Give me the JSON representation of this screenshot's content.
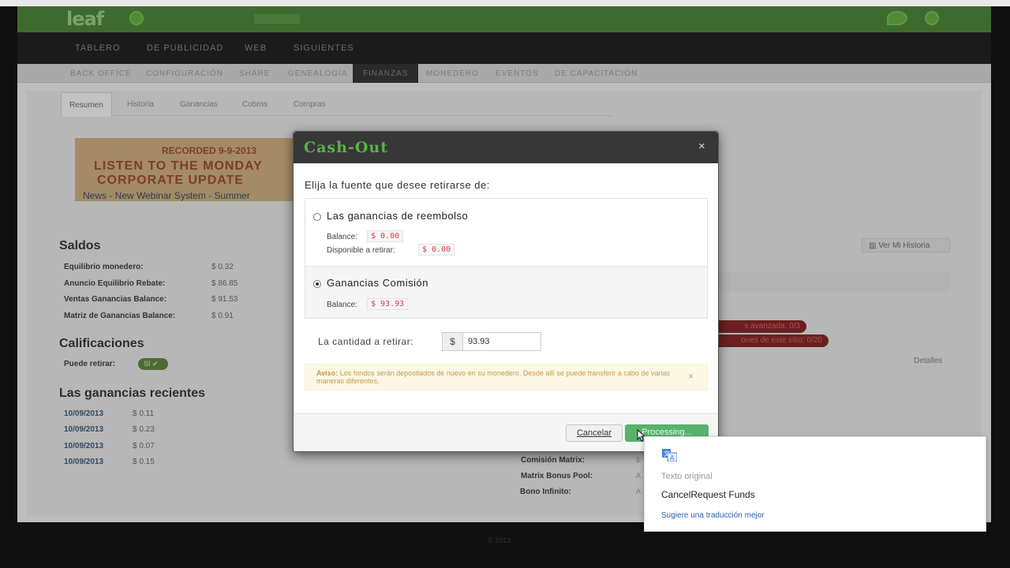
{
  "app": {
    "logo": "leaf"
  },
  "nav_main": [
    "TABLERO",
    "DE PUBLICIDAD",
    "WEB",
    "SIGUIENTES"
  ],
  "nav_sub": [
    "BACK OFFICE",
    "CONFIGURACIÓN",
    "SHARE",
    "GENEALOGÍA",
    "FINANZAS",
    "MONEDERO",
    "EVENTOS",
    "DE CAPACITACIÓN"
  ],
  "tabs": [
    "Resumen",
    "Historia",
    "Ganancias",
    "Cobros",
    "Compras"
  ],
  "banner": {
    "recorded": "RECORDED 9-9-2013",
    "line1": "LISTEN TO THE MONDAY",
    "line2": "CORPORATE UPDATE",
    "line3": "News  -  New Webinar System  -  Summer"
  },
  "saldos": {
    "title": "Saldos",
    "rows": [
      {
        "label": "Equilibrio monedero:",
        "value": "$ 0.32"
      },
      {
        "label": "Anuncio Equilibrio Rebate:",
        "value": "$ 86.85"
      },
      {
        "label": "Ventas Ganancias Balance:",
        "value": "$ 91.53"
      },
      {
        "label": "Matriz de Ganancias Balance:",
        "value": "$ 0.91"
      }
    ]
  },
  "calificaciones": {
    "title": "Calificaciones",
    "label": "Puede retirar:",
    "badge": "SI ✔"
  },
  "recientes": {
    "title": "Las ganancias recientes",
    "rows": [
      {
        "date": "10/09/2013",
        "amount": "$ 0.11"
      },
      {
        "date": "10/09/2013",
        "amount": "$ 0.23"
      },
      {
        "date": "10/09/2013",
        "amount": "$ 0.07"
      },
      {
        "date": "10/09/2013",
        "amount": "$ 0.15"
      }
    ]
  },
  "right_panel": {
    "history_button": "Ver Mi Historia",
    "pill1": "s avanzada: 0/3",
    "pill2": "ones de este sitio: 0/20",
    "detalles": "Detalles",
    "rows": [
      {
        "label": "Comisión Matrix:",
        "value": "$"
      },
      {
        "label": "Matrix Bonus Pool:",
        "value": "A"
      },
      {
        "label": "Bono Infinito:",
        "value": "A"
      }
    ]
  },
  "modal": {
    "title": "Cash-Out",
    "close": "×",
    "prompt": "Elija la fuente que desee retirarse de:",
    "sources": [
      {
        "name": "Las ganancias de reembolso",
        "balance_label": "Balance:",
        "balance": "$ 0.00",
        "available_label": "Disponible a retirar:",
        "available": "$ 0.00",
        "selected": false
      },
      {
        "name": "Ganancias Comisión",
        "balance_label": "Balance:",
        "balance": "$ 93.93",
        "selected": true
      }
    ],
    "amount_label": "La cantidad a retirar:",
    "currency": "$",
    "amount_value": "93.93",
    "alert_strong": "Aviso:",
    "alert_text": "Los fondos serán depositados de nuevo en su monedero. Desde allí se puede transferir a cabo de varias maneras diferentes.",
    "alert_close": "×",
    "cancel_label": "Cancelar",
    "process_label": "Processing..."
  },
  "translate_popup": {
    "original_label": "Texto original",
    "original_text": "CancelRequest Funds",
    "suggest_link": "Sugiere una traducción mejor"
  },
  "colors": {
    "brand_green": "#3e6b2d",
    "modal_title_green": "#5ab24a",
    "money_red": "#d33b4a",
    "process_button": "#57b36c",
    "alert_bg": "#fcf8e3",
    "link_blue": "#2a5db0"
  },
  "icons": [
    "close-icon",
    "chart-icon",
    "check-icon",
    "google-translate-icon",
    "mouse-cursor-icon"
  ]
}
